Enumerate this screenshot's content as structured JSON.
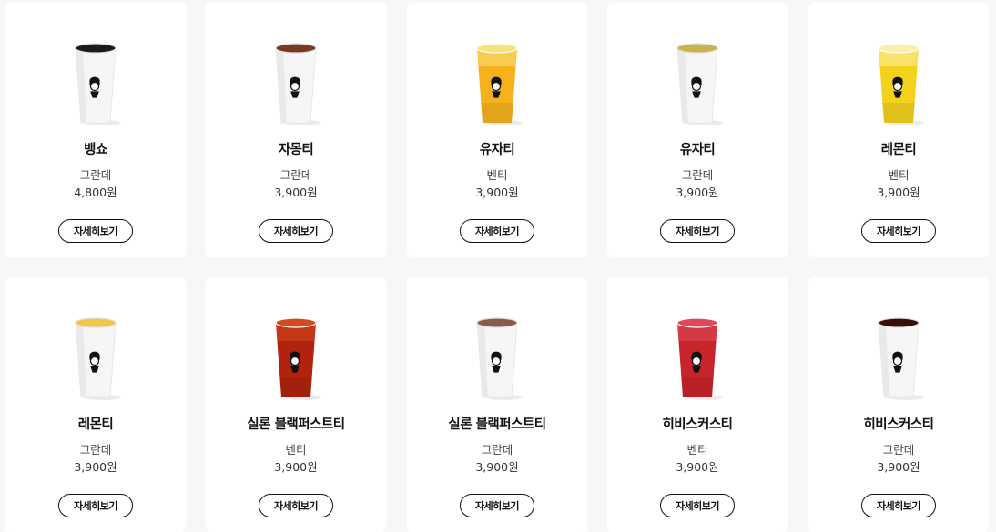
{
  "products": [
    {
      "name": "뱅쇼",
      "size": "그란데",
      "price": "4,800원",
      "detail_label": "자세히보기",
      "liquid": "#c8511c",
      "top": "#1b1b1b",
      "clear": false,
      "icon": "drink-cup-icon"
    },
    {
      "name": "자몽티",
      "size": "그란데",
      "price": "3,900원",
      "detail_label": "자세히보기",
      "liquid": "#7a3a22",
      "top": "#7a3a22",
      "clear": false,
      "icon": "drink-cup-icon"
    },
    {
      "name": "유자티",
      "size": "벤티",
      "price": "3,900원",
      "detail_label": "자세히보기",
      "liquid": "#f6b21d",
      "top": "#f8e27a",
      "clear": true,
      "icon": "drink-cup-icon"
    },
    {
      "name": "유자티",
      "size": "그란데",
      "price": "3,900원",
      "detail_label": "자세히보기",
      "liquid": "#c9b44a",
      "top": "#c9b44a",
      "clear": false,
      "icon": "drink-cup-icon"
    },
    {
      "name": "레몬티",
      "size": "벤티",
      "price": "3,900원",
      "detail_label": "자세히보기",
      "liquid": "#f3d21c",
      "top": "#fbf0a8",
      "clear": true,
      "icon": "drink-cup-icon"
    },
    {
      "name": "레몬티",
      "size": "그란데",
      "price": "3,900원",
      "detail_label": "자세히보기",
      "liquid": "#e6b13a",
      "top": "#f3c54a",
      "clear": false,
      "icon": "drink-cup-icon"
    },
    {
      "name": "실론 블랙퍼스트티",
      "size": "벤티",
      "price": "3,900원",
      "detail_label": "자세히보기",
      "liquid": "#b1230f",
      "top": "#d44a20",
      "clear": true,
      "icon": "drink-cup-icon"
    },
    {
      "name": "실론 블랙퍼스트티",
      "size": "그란데",
      "price": "3,900원",
      "detail_label": "자세히보기",
      "liquid": "#8a5a4a",
      "top": "#8a5a4a",
      "clear": false,
      "icon": "drink-cup-icon"
    },
    {
      "name": "히비스커스티",
      "size": "벤티",
      "price": "3,900원",
      "detail_label": "자세히보기",
      "liquid": "#c8242c",
      "top": "#e04a58",
      "clear": true,
      "icon": "drink-cup-icon"
    },
    {
      "name": "히비스커스티",
      "size": "그란데",
      "price": "3,900원",
      "detail_label": "자세히보기",
      "liquid": "#3a0d0a",
      "top": "#3a0d0a",
      "clear": false,
      "icon": "drink-cup-icon"
    }
  ]
}
